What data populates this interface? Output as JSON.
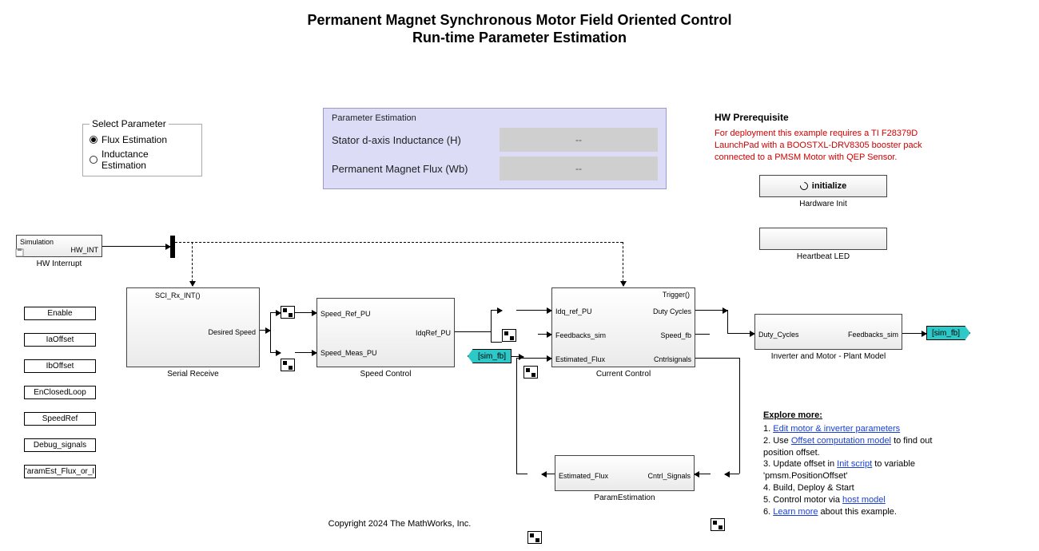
{
  "title": {
    "line1": "Permanent Magnet Synchronous Motor Field Oriented Control",
    "line2": "Run-time Parameter Estimation"
  },
  "paramSelect": {
    "legend": "Select Parameter",
    "opt1": "Flux Estimation",
    "opt2": "Inductance Estimation"
  },
  "peTable": {
    "title": "Parameter Estimation",
    "row1_label": "Stator d-axis Inductance  (H)",
    "row1_value": "--",
    "row2_label": "Permanent Magnet Flux (Wb)",
    "row2_value": "--"
  },
  "hw": {
    "title": "HW Prerequisite",
    "text": "For deployment this example requires a TI F28379D LaunchPad with a BOOSTXL-DRV8305 booster pack connected to a PMSM Motor with QEP Sensor."
  },
  "buttons": {
    "initialize": "initialize",
    "hw_init_caption": "Hardware Init",
    "heartbeat_caption": "Heartbeat LED"
  },
  "hwint": {
    "top": "Simulation",
    "port": "HW_INT",
    "caption": "HW Interrupt"
  },
  "tags": {
    "enable": "Enable",
    "iaoffset": "IaOffset",
    "iboffset": "IbOffset",
    "enclosed": "EnClosedLoop",
    "speedref": "SpeedRef",
    "debug": "Debug_signals",
    "paramest": "'aramEst_Flux_or_I",
    "simfb": "[sim_fb]"
  },
  "serialRx": {
    "port_top": "SCI_Rx_INT()",
    "port_out": "Desired Speed",
    "caption": "Serial Receive"
  },
  "speedCtrl": {
    "in1": "Speed_Ref_PU",
    "in2": "Speed_Meas_PU",
    "out": "IdqRef_PU",
    "caption": "Speed Control"
  },
  "currentCtrl": {
    "trig": "Trigger()",
    "in1": "Idq_ref_PU",
    "in2": "Feedbacks_sim",
    "in3": "Estimated_Flux",
    "out1": "Duty Cycles",
    "out2": "Speed_fb",
    "out3": "Cntrlsignals",
    "caption": "Current Control"
  },
  "plant": {
    "in": "Duty_Cycles",
    "out": "Feedbacks_sim",
    "caption": "Inverter and Motor - Plant Model"
  },
  "paramEst": {
    "in": "Cntrl_Signals",
    "out": "Estimated_Flux",
    "caption": "ParamEstimation"
  },
  "explore": {
    "title": "Explore more:",
    "l1a": "1. ",
    "l1link": "Edit motor & inverter parameters",
    "l2a": "2. Use ",
    "l2link": "Offset computation model",
    "l2b": " to find out position offset.",
    "l3a": "3. Update offset in ",
    "l3link": "Init script",
    "l3b": " to variable 'pmsm.PositionOffset'",
    "l4": "4. Build, Deploy & Start",
    "l5a": "5. Control motor via ",
    "l5link": "host model",
    "l6a": "6. ",
    "l6link": "Learn more",
    "l6b": " about this example."
  },
  "copyright": "Copyright 2024 The MathWorks, Inc."
}
